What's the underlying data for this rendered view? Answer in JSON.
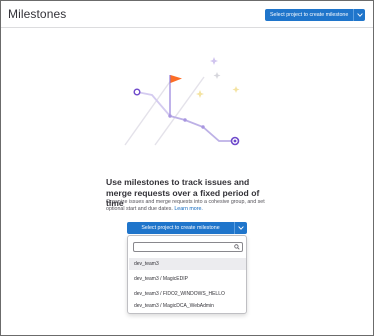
{
  "header": {
    "title": "Milestones",
    "button_label": "Select project to create milestone"
  },
  "empty_state": {
    "title": "Use milestones to track issues and merge requests over a fixed period of time",
    "description": "Organize issues and merge requests into a cohesive group, and set optional start and due dates.",
    "learn_more": "Learn more."
  },
  "create_button": {
    "label": "Select project to create milestone"
  },
  "dropdown": {
    "search_placeholder": "",
    "options": [
      "dev_team3",
      "dev_team3 / MagicEDIP",
      "dev_team3 / FIDO2_WINDOWS_HELLO",
      "dev_team3 / MagicDCA_WebAdmin"
    ]
  },
  "colors": {
    "primary": "#1f75cb",
    "illustration_purple": "#6e49cb",
    "illustration_flag": "#fc6d26"
  },
  "icons": [
    "chevron-down-icon",
    "search-icon",
    "milestone-illustration"
  ]
}
